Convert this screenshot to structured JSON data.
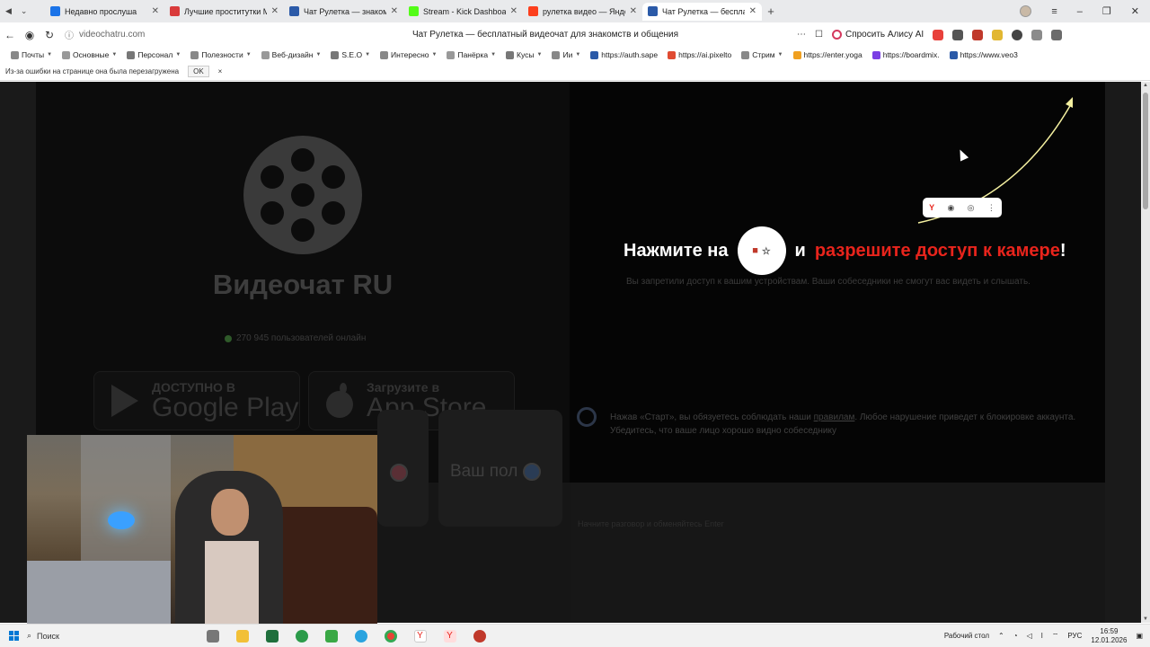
{
  "browser": {
    "tabs": [
      {
        "title": "Недавно прослуша",
        "color": "#1a73e8",
        "active": false
      },
      {
        "title": "Лучшие проститутки Мо",
        "color": "#d93b3b",
        "active": false
      },
      {
        "title": "Чат Рулетка — знакомс",
        "color": "#2b5aa8",
        "active": false
      },
      {
        "title": "Stream - Kick Dashboard",
        "color": "#53fc18",
        "active": false
      },
      {
        "title": "рулетка видео — Яндекс",
        "color": "#fc3f1d",
        "active": false
      },
      {
        "title": "Чат Рулетка — бесплат",
        "color": "#2b5aa8",
        "active": true
      }
    ],
    "url": "videochatru.com",
    "page_title": "Чат Рулетка — бесплатный видеочат для знакомств и общения",
    "alice_label": "Спросить Алису AI",
    "bookmarks": [
      {
        "label": "Почты",
        "folder": true
      },
      {
        "label": "Основные",
        "folder": true
      },
      {
        "label": "Персонал",
        "folder": true
      },
      {
        "label": "Полезности",
        "folder": true
      },
      {
        "label": "Веб-дизайн",
        "folder": true
      },
      {
        "label": "S.E.O",
        "folder": true
      },
      {
        "label": "Интересно",
        "folder": true
      },
      {
        "label": "Панёрка",
        "folder": true
      },
      {
        "label": "Кусы",
        "folder": true
      },
      {
        "label": "Ии",
        "folder": true
      },
      {
        "label": "https://auth.sape",
        "folder": false
      },
      {
        "label": "https://ai.pixelto",
        "folder": false
      },
      {
        "label": "Стрим",
        "folder": true
      },
      {
        "label": "https://enter.yoga",
        "folder": false
      },
      {
        "label": "https://boardmix.",
        "folder": false
      },
      {
        "label": "https://www.veo3",
        "folder": false
      }
    ],
    "infobar_text": "Из-за ошибки на странице она была перезагружена",
    "infobar_ok": "OK",
    "infobar_close": "×"
  },
  "site": {
    "brand": "Видеочат RU",
    "online_text": "270 945 пользователей онлайн",
    "google_play_small": "ДОСТУПНО В",
    "google_play_large": "Google Play",
    "app_store_small": "Загрузите в",
    "app_store_large": "App Store",
    "prompt_prefix": "Нажмите на",
    "prompt_mid": "и",
    "prompt_red": "разрешите доступ к камере",
    "prompt_suffix": "!",
    "sub_text": "Вы запретили доступ к вашим устройствам. Ваши собеседники не смогут вас видеть и слышать.",
    "gender_label": "Ваш пол",
    "rules_text_1": "Нажав «Старт», вы обязуетесь соблюдать наши ",
    "rules_link": "правилам",
    "rules_text_2": ". Любое нарушение приведет к блокировке аккаунта. Убедитесь, что ваше лицо хорошо видно собеседнику",
    "message_placeholder": "Начните разговор и обменяйтесь Enter",
    "accent_red": "#e8241c"
  },
  "taskbar": {
    "search_label": "Поиск",
    "desktop_label": "Рабочий стол",
    "language": "РУС",
    "time": "16:59",
    "date": "12.01.2026"
  }
}
